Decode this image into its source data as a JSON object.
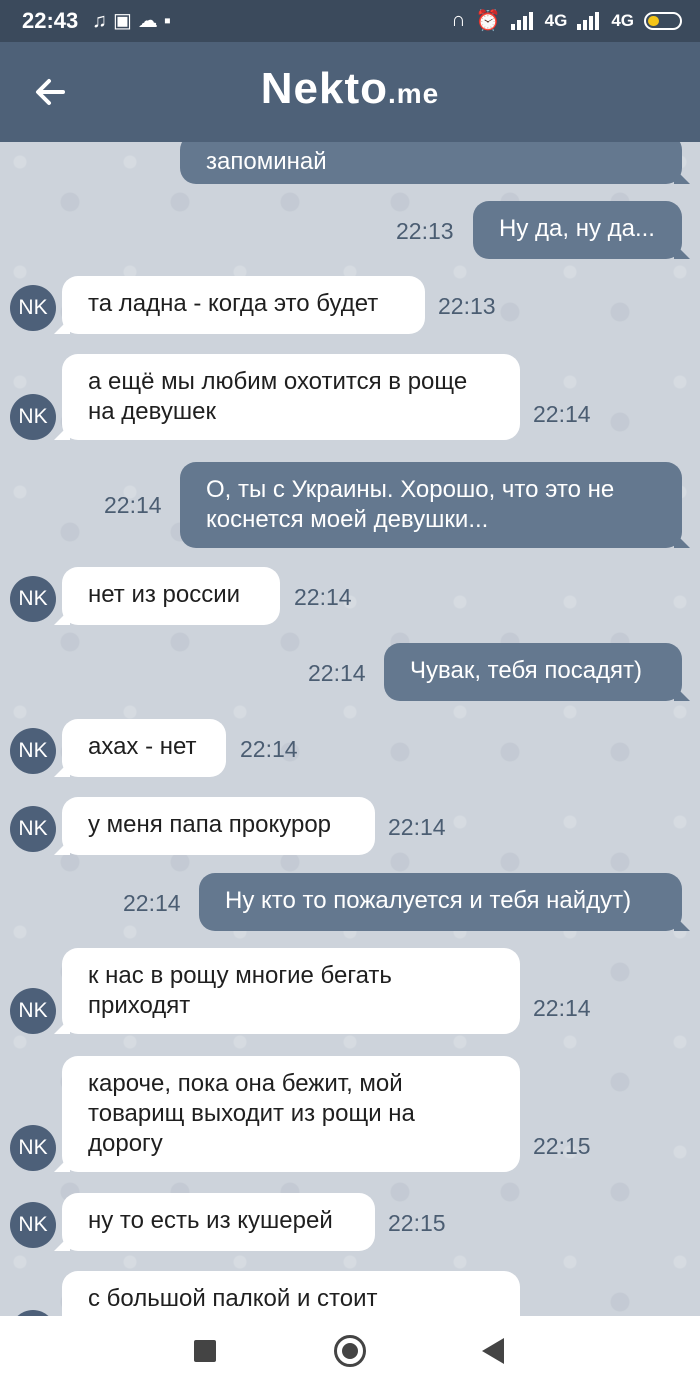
{
  "status_bar": {
    "time": "22:43",
    "network_1": "4G",
    "network_2": "4G",
    "left_icons": [
      "music-icon",
      "message-icon",
      "cloud-icon",
      "taxi-icon"
    ],
    "right_icons": [
      "headphones-icon",
      "alarm-icon",
      "signal-icon",
      "signal-icon",
      "battery-icon"
    ],
    "battery_level": 0.35
  },
  "header": {
    "title": "Nekto",
    "title_suffix": ".me",
    "back_icon": "arrow-left-icon"
  },
  "messages": [
    {
      "dir": "out",
      "text": "запоминай",
      "time": ""
    },
    {
      "dir": "out",
      "text": "Ну да, ну да...",
      "time": "22:13"
    },
    {
      "dir": "in",
      "avatar": "NK",
      "text": "та ладна - когда это будет",
      "time": "22:13"
    },
    {
      "dir": "in",
      "avatar": "NK",
      "text": "а ещё мы любим охотится в роще на девушек",
      "time": "22:14"
    },
    {
      "dir": "out",
      "text": "О, ты с Украины. Хорошо, что это не коснется моей девушки...",
      "time": "22:14"
    },
    {
      "dir": "in",
      "avatar": "NK",
      "text": "нет из россии",
      "time": "22:14"
    },
    {
      "dir": "out",
      "text": "Чувак, тебя посадят)",
      "time": "22:14"
    },
    {
      "dir": "in",
      "avatar": "NK",
      "text": "ахах - нет",
      "time": "22:14"
    },
    {
      "dir": "in",
      "avatar": "NK",
      "text": "у меня папа прокурор",
      "time": "22:14"
    },
    {
      "dir": "out",
      "text": "Ну кто то пожалуется и тебя найдут)",
      "time": "22:14"
    },
    {
      "dir": "in",
      "avatar": "NK",
      "text": "к нас в рощу многие бегать приходят",
      "time": "22:14"
    },
    {
      "dir": "in",
      "avatar": "NK",
      "text": "кароче, пока она бежит, мой товарищ выходит из рощи на дорогу",
      "time": "22:15"
    },
    {
      "dir": "in",
      "avatar": "NK",
      "text": "ну то есть из кушерей",
      "time": "22:15"
    },
    {
      "dir": "in",
      "avatar": "NK",
      "text": "с большой палкой и стоит",
      "time": ""
    }
  ],
  "nav": {
    "recents_icon": "square-icon",
    "home_icon": "circle-icon",
    "back_icon": "triangle-back-icon"
  },
  "colors": {
    "status_bar": "#3b4a5c",
    "header": "#4e6178",
    "outgoing_bubble": "#64788f",
    "incoming_bubble": "#ffffff",
    "chat_bg": "#cdd3db",
    "avatar": "#4d6079",
    "battery": "#f5c518"
  }
}
